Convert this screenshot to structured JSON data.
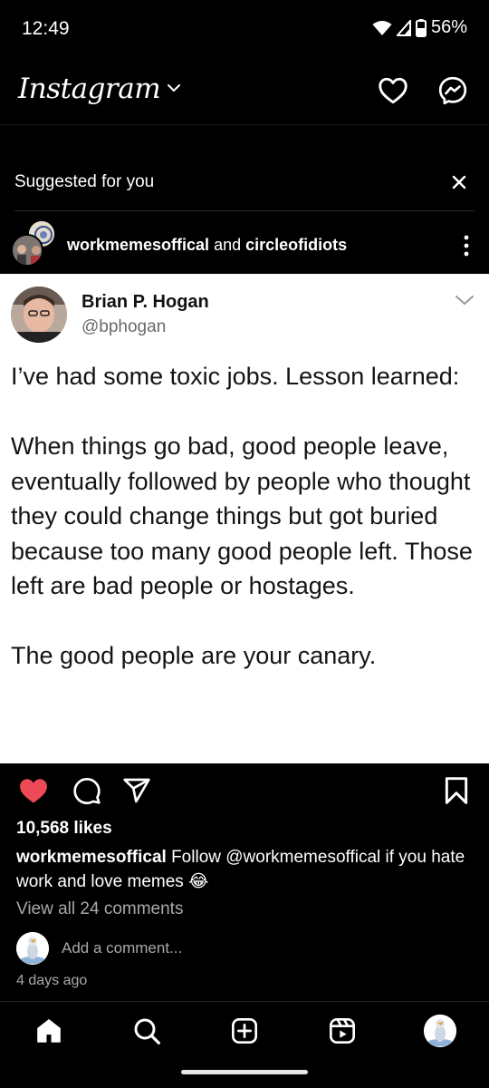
{
  "status_bar": {
    "time": "12:49",
    "battery": "56%",
    "icons": [
      "wifi-icon",
      "signal-icon",
      "battery-icon"
    ]
  },
  "header": {
    "logo": "Instagram",
    "icons": [
      "chevron-down-icon",
      "heart-icon",
      "messenger-icon"
    ]
  },
  "suggested": {
    "label": "Suggested for you",
    "close_icon": "close-icon"
  },
  "post": {
    "author1": "workmemesoffical",
    "joiner": " and ",
    "author2": "circleofidiots",
    "more_icon": "more-vertical-icon",
    "tweet": {
      "name": "Brian P. Hogan",
      "handle": "@bphogan",
      "paragraphs": [
        "I’ve had some toxic jobs. Lesson learned:",
        "When things go bad, good people leave, eventually followed by people who thought they could change things but got buried because too many good people left. Those left are bad people or hostages.",
        "The good people are your canary."
      ]
    },
    "actions": {
      "liked": true,
      "like_color": "#ed4956",
      "icons": [
        "heart-filled-icon",
        "comment-icon",
        "share-icon",
        "bookmark-icon"
      ]
    },
    "likes": "10,568 likes",
    "caption": {
      "user": "workmemesoffical",
      "text": " Follow @workmemesoffical if you hate work and love memes 😂"
    },
    "view_comments": "View all 24 comments",
    "add_comment_placeholder": "Add a comment...",
    "timestamp": "4 days ago"
  },
  "nav": {
    "items": [
      "home-icon",
      "search-icon",
      "create-icon",
      "reels-icon",
      "profile-avatar"
    ],
    "active": "home-icon"
  }
}
